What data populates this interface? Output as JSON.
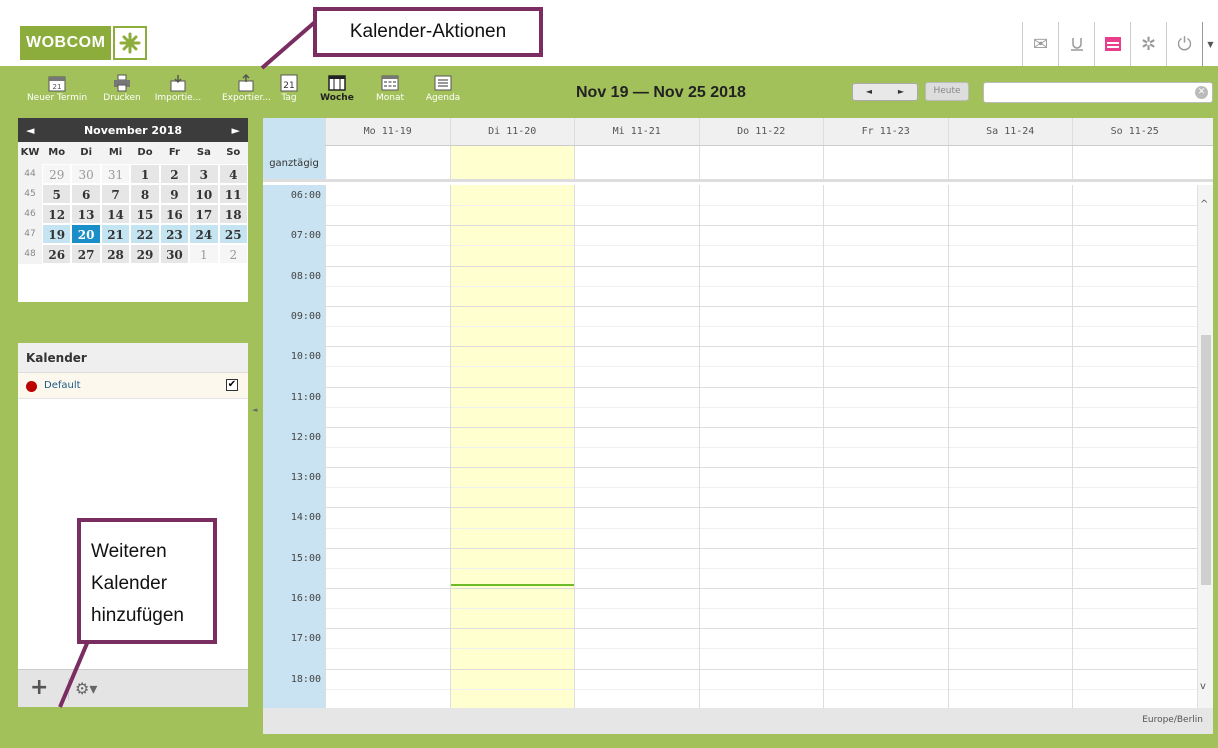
{
  "logo": {
    "text": "WOBCOM"
  },
  "toolbar": {
    "new_event": "Neuer Termin",
    "print": "Drucken",
    "import": "Importie...",
    "export": "Exportier...",
    "day": "Tag",
    "week": "Woche",
    "month": "Monat",
    "agenda": "Agenda",
    "day_icon_number": "21",
    "new_icon_number": "21",
    "range_title": "Nov 19 — Nov 25 2018",
    "prev": "◄",
    "next": "►",
    "today": "Heute",
    "search_placeholder": ""
  },
  "mini_calendar": {
    "month_title": "November 2018",
    "prev": "◄",
    "next": "►",
    "headers": [
      "KW",
      "Mo",
      "Di",
      "Mi",
      "Do",
      "Fr",
      "Sa",
      "So"
    ],
    "weeks": [
      {
        "kw": "44",
        "days": [
          "29",
          "30",
          "31",
          "1",
          "2",
          "3",
          "4"
        ]
      },
      {
        "kw": "45",
        "days": [
          "5",
          "6",
          "7",
          "8",
          "9",
          "10",
          "11"
        ]
      },
      {
        "kw": "46",
        "days": [
          "12",
          "13",
          "14",
          "15",
          "16",
          "17",
          "18"
        ]
      },
      {
        "kw": "47",
        "days": [
          "19",
          "20",
          "21",
          "22",
          "23",
          "24",
          "25"
        ]
      },
      {
        "kw": "48",
        "days": [
          "26",
          "27",
          "28",
          "29",
          "30",
          "1",
          "2"
        ]
      }
    ]
  },
  "calendars": {
    "title": "Kalender",
    "items": [
      {
        "name": "Default",
        "checked": "✔",
        "color": "#bb0000"
      }
    ]
  },
  "week_view": {
    "days": [
      "Mo 11-19",
      "Di 11-20",
      "Mi 11-21",
      "Do 11-22",
      "Fr 11-23",
      "Sa 11-24",
      "So 11-25"
    ],
    "allday_label": "ganztägig",
    "hours": [
      "06:00",
      "07:00",
      "08:00",
      "09:00",
      "10:00",
      "11:00",
      "12:00",
      "13:00",
      "14:00",
      "15:00",
      "16:00",
      "17:00",
      "18:00"
    ],
    "timezone": "Europe/Berlin"
  },
  "annotations": {
    "top": "Kalender-Aktionen",
    "left": "Weiteren Kalender hinzufügen"
  },
  "colors": {
    "frame": "#a2c15a",
    "accent": "#7a2d61",
    "today": "#ffffd0",
    "selected": "#1a8ec9"
  }
}
